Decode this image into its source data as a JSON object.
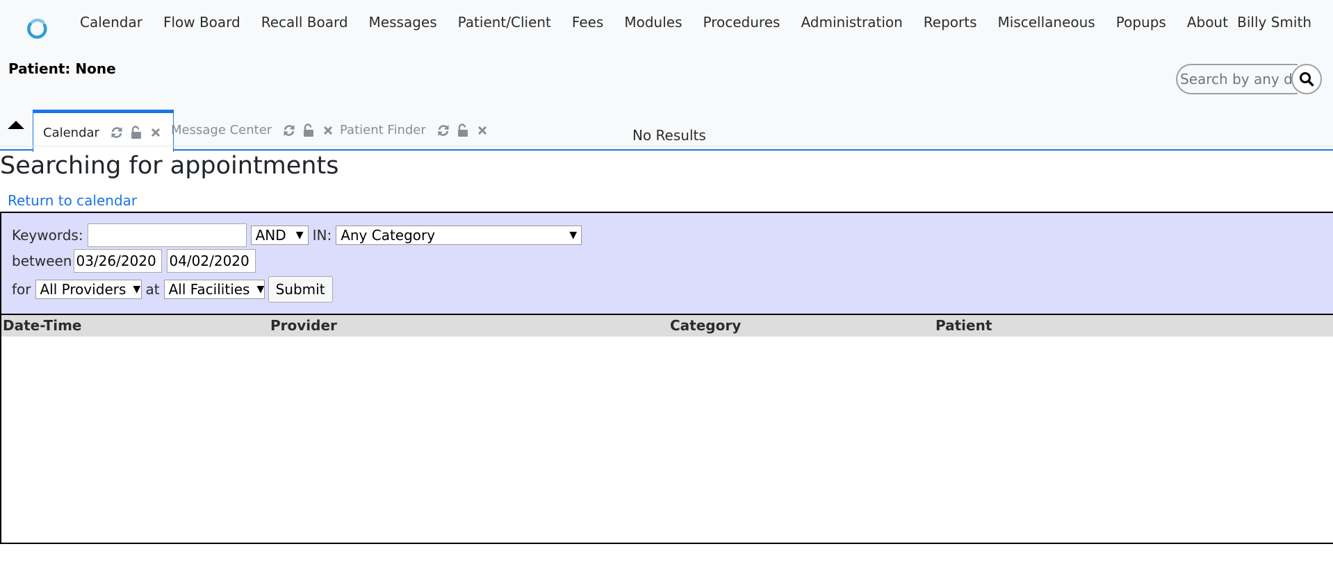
{
  "menu": {
    "items": [
      "Calendar",
      "Flow Board",
      "Recall Board",
      "Messages",
      "Patient/Client",
      "Fees",
      "Modules",
      "Procedures",
      "Administration",
      "Reports",
      "Miscellaneous",
      "Popups",
      "About"
    ],
    "user_name": "Billy Smith"
  },
  "patient": {
    "label": "Patient: None"
  },
  "search": {
    "placeholder": "Search by any demographics"
  },
  "tabs": [
    {
      "label": "Calendar",
      "active": true
    },
    {
      "label": "Message Center",
      "active": false
    },
    {
      "label": "Patient Finder",
      "active": false
    }
  ],
  "page": {
    "title": "Searching for appointments",
    "return_link": "Return to calendar"
  },
  "form": {
    "keywords_label": "Keywords:",
    "keywords_value": "",
    "operator": "AND",
    "in_label": "IN:",
    "category": "Any Category",
    "between_label": "between",
    "date_from": "03/26/2020",
    "date_to": "04/02/2020",
    "for_label": "for",
    "provider": "All Providers",
    "at_label": "at",
    "facility": "All Facilities",
    "submit_label": "Submit"
  },
  "results": {
    "columns": [
      "Date-Time",
      "Provider",
      "Category",
      "Patient"
    ],
    "empty_message": "No Results"
  },
  "colors": {
    "accent": "#1a73e8",
    "form_bg": "#dcdcfc",
    "header_bg": "#dddddd",
    "topbar_bg": "#f8f9fa"
  },
  "icons": {
    "logo": "openemr-logo-icon",
    "search": "search-icon",
    "collapse": "caret-up-icon",
    "tab_refresh": "refresh-icon",
    "tab_lock": "unlock-icon",
    "tab_close": "close-icon"
  }
}
